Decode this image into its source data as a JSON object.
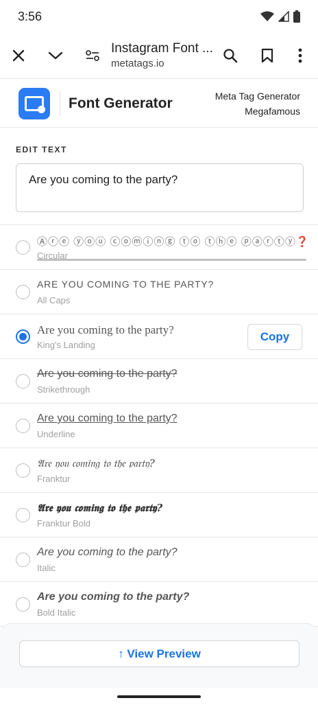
{
  "status_bar": {
    "time": "3:56"
  },
  "browser": {
    "page_title": "Instagram Font ...",
    "domain": "metatags.io"
  },
  "site": {
    "brand": "Font Generator",
    "links": [
      "Meta Tag Generator",
      "Megafamous"
    ]
  },
  "editor": {
    "label": "EDIT TEXT",
    "value": "Are you coming to the party?"
  },
  "fonts": [
    {
      "text": "Ⓐⓡⓔ ⓨⓞⓤ ⓒⓞⓜⓘⓝⓖ ⓣⓞ ⓣⓗⓔ ⓟⓐⓡⓣⓨ❓",
      "name": "Circular",
      "selected": false
    },
    {
      "text": "ARE YOU COMING TO THE PARTY?",
      "name": "All Caps",
      "selected": false
    },
    {
      "text": "Are you coming to the party?",
      "name": "King's Landing",
      "selected": true
    },
    {
      "text": "Are you coming to the party?",
      "name": "Strikethrough",
      "selected": false
    },
    {
      "text": "Are you coming to the party?",
      "name": "Underline",
      "selected": false
    },
    {
      "text": "𝔄𝔯𝔢 𝔶𝔬𝔲 𝔠𝔬𝔪𝔦𝔫𝔤 𝔱𝔬 𝔱𝔥𝔢 𝔭𝔞𝔯𝔱𝔶?",
      "name": "Franktur",
      "selected": false
    },
    {
      "text": "𝕬𝖗𝖊 𝖞𝖔𝖚 𝖈𝖔𝖒𝖎𝖓𝖌 𝖙𝖔 𝖙𝖍𝖊 𝖕𝖆𝖗𝖙𝖞?",
      "name": "Franktur Bold",
      "selected": false
    },
    {
      "text": "Are you coming to the party?",
      "name": "Italic",
      "selected": false
    },
    {
      "text": "Are you coming to the party?",
      "name": "Bold Italic",
      "selected": false
    }
  ],
  "copy_label": "Copy",
  "preview_label": "↑ View Preview",
  "colors": {
    "accent": "#1a73e8",
    "logo": "#2b7bf3"
  }
}
